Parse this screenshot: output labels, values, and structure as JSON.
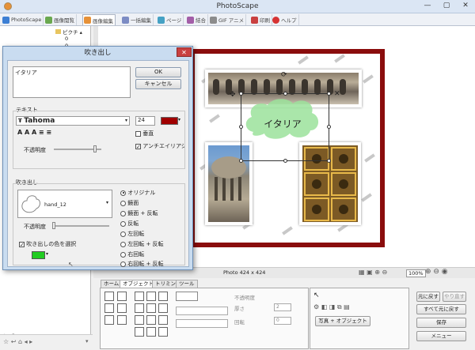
{
  "app": {
    "title": "PhotoScape"
  },
  "window": {
    "minimize": "—",
    "maximize": "▢",
    "close": "✕"
  },
  "tabs": [
    {
      "label": "PhotoScape",
      "color": "#3d7fd4"
    },
    {
      "label": "画像閲覧",
      "color": "#6aa84f"
    },
    {
      "label": "画像編集",
      "color": "#e69138"
    },
    {
      "label": "一括編集",
      "color": "#7c8cc4"
    },
    {
      "label": "ページ",
      "color": "#45a1c4"
    },
    {
      "label": "結合",
      "color": "#a35ea8"
    },
    {
      "label": "GIF アニメ",
      "color": "#8c8c8c"
    },
    {
      "label": "印刷",
      "color": "#c94040"
    },
    {
      "label": "ヘルプ",
      "color": "#d63333"
    }
  ],
  "tree": {
    "node": "ピクチ",
    "items": [
      "0",
      "0",
      "1"
    ]
  },
  "canvas": {
    "bubble_text": "イタリア"
  },
  "status": {
    "photo_info": "Photo 424 x 424",
    "zoom": "100%"
  },
  "dialog": {
    "title": "吹き出し",
    "close": "✕",
    "text_value": "イタリア",
    "ok": "OK",
    "cancel": "キャンセル",
    "text_group": "テキスト",
    "font": "Tahoma",
    "font_size": "24",
    "text_color": "#a00000",
    "vertical": "垂直",
    "antialias": "アンチエイリアシング",
    "opacity": "不透明度",
    "bubble_group": "吹き出し",
    "bubble_name": "hand_12",
    "bubble_opacity": "不透明度",
    "use_color": "吹き出しの色を選択",
    "bubble_color": "#22cc22",
    "orientations": [
      "オリジナル",
      "鏡面",
      "鏡面 + 反転",
      "反転",
      "左回転",
      "左回転 + 反転",
      "右回転",
      "右回転 + 反転"
    ],
    "selected_orientation": 0
  },
  "bottom": {
    "tabs": [
      "ホーム",
      "オブジェクト",
      "トリミング",
      "ツール"
    ],
    "active_tab": 1,
    "opacity": "不透明度",
    "thickness": "厚さ",
    "rotation": "回転",
    "thickness_value": "2",
    "rotation_value": "0",
    "photo_object": "写真 + オブジェクト",
    "undo": "元に戻す",
    "redo": "やり直す",
    "undo_all": "すべて元に戻す",
    "save": "保存",
    "menu": "メニュー"
  }
}
